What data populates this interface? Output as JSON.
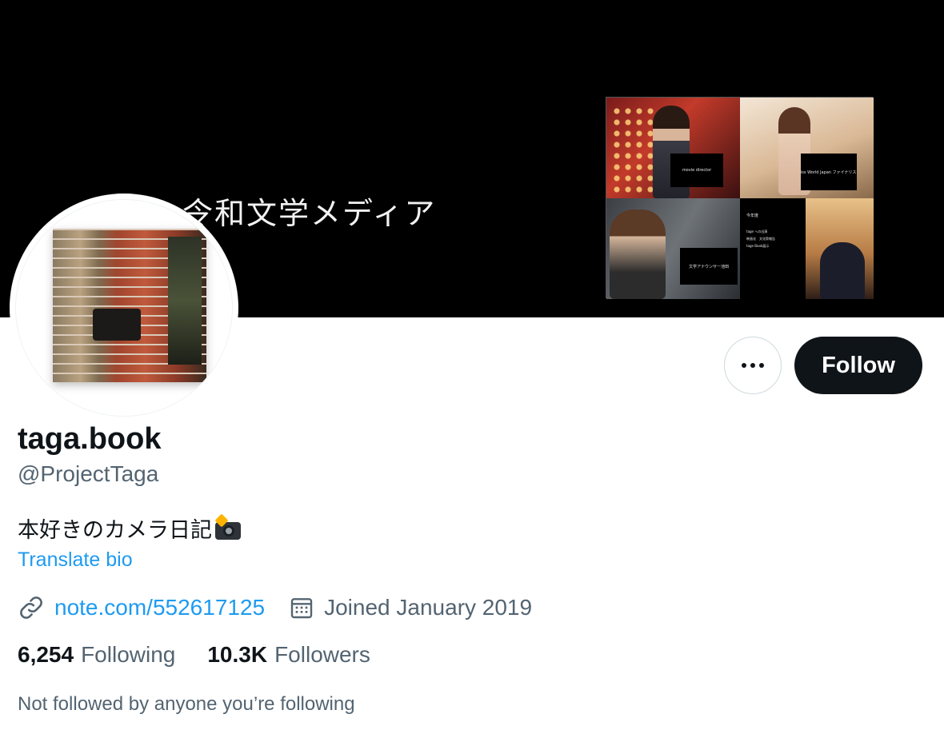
{
  "banner": {
    "title": "令和文学メディア",
    "tile_captions": [
      "movie director",
      "Miss World Japan ファイナリスト",
      "文学アナウンサー池田"
    ],
    "tile_list": {
      "head": "今年度",
      "lines": [
        "tage への出演",
        "映画化　文化祭報告",
        "tage Book展示"
      ]
    }
  },
  "profile": {
    "display_name": "taga.book",
    "handle": "@ProjectTaga",
    "bio": "本好きのカメラ日記",
    "translate_label": "Translate bio",
    "website": "note.com/552617125",
    "joined": "Joined January 2019"
  },
  "actions": {
    "follow_label": "Follow"
  },
  "stats": {
    "following_count": "6,254",
    "following_label": "Following",
    "followers_count": "10.3K",
    "followers_label": "Followers"
  },
  "followed_by": "Not followed by anyone you’re following",
  "colors": {
    "accent": "#1d9bf0",
    "text_primary": "#0f1419",
    "text_secondary": "#536471",
    "follow_button_bg": "#0f1419"
  },
  "icons": [
    "more-icon",
    "link-icon",
    "calendar-icon",
    "camera-flash-emoji"
  ]
}
